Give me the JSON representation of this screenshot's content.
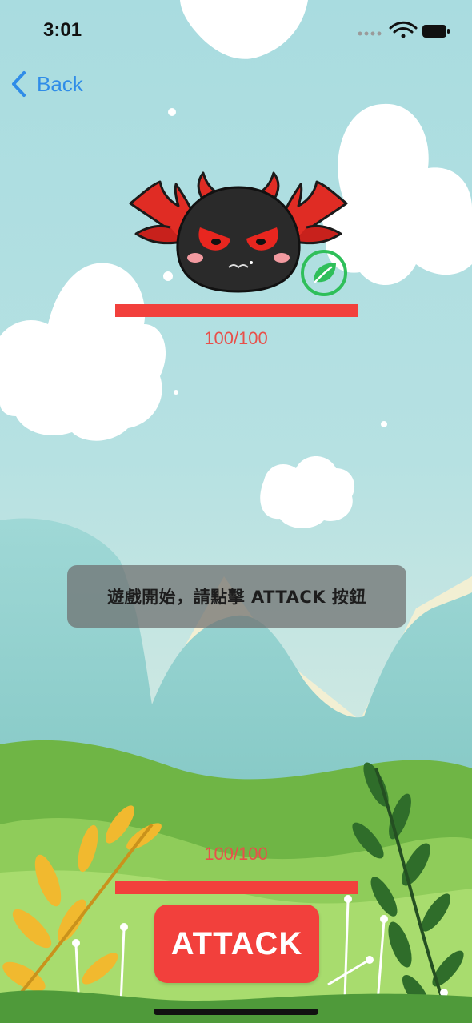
{
  "status_bar": {
    "time": "3:01",
    "icons": [
      "signal-dots-icon",
      "wifi-icon",
      "battery-icon"
    ]
  },
  "nav": {
    "back_label": "Back",
    "back_icon": "chevron-left-icon"
  },
  "enemy": {
    "sprite": "bat-winged-devil-blob",
    "element_icon": "leaf-icon",
    "hp_text": "100/100",
    "hp_fraction": 1.0
  },
  "player": {
    "hp_text": "100/100",
    "hp_fraction": 1.0
  },
  "message": {
    "text": "遊戲開始，請點擊 ATTACK 按鈕"
  },
  "actions": {
    "attack_label": "ATTACK"
  },
  "colors": {
    "accent": "#2f8ce8",
    "hp": "#f2403c",
    "hp_text": "#e8504a",
    "element_green": "#2fbf5a"
  }
}
